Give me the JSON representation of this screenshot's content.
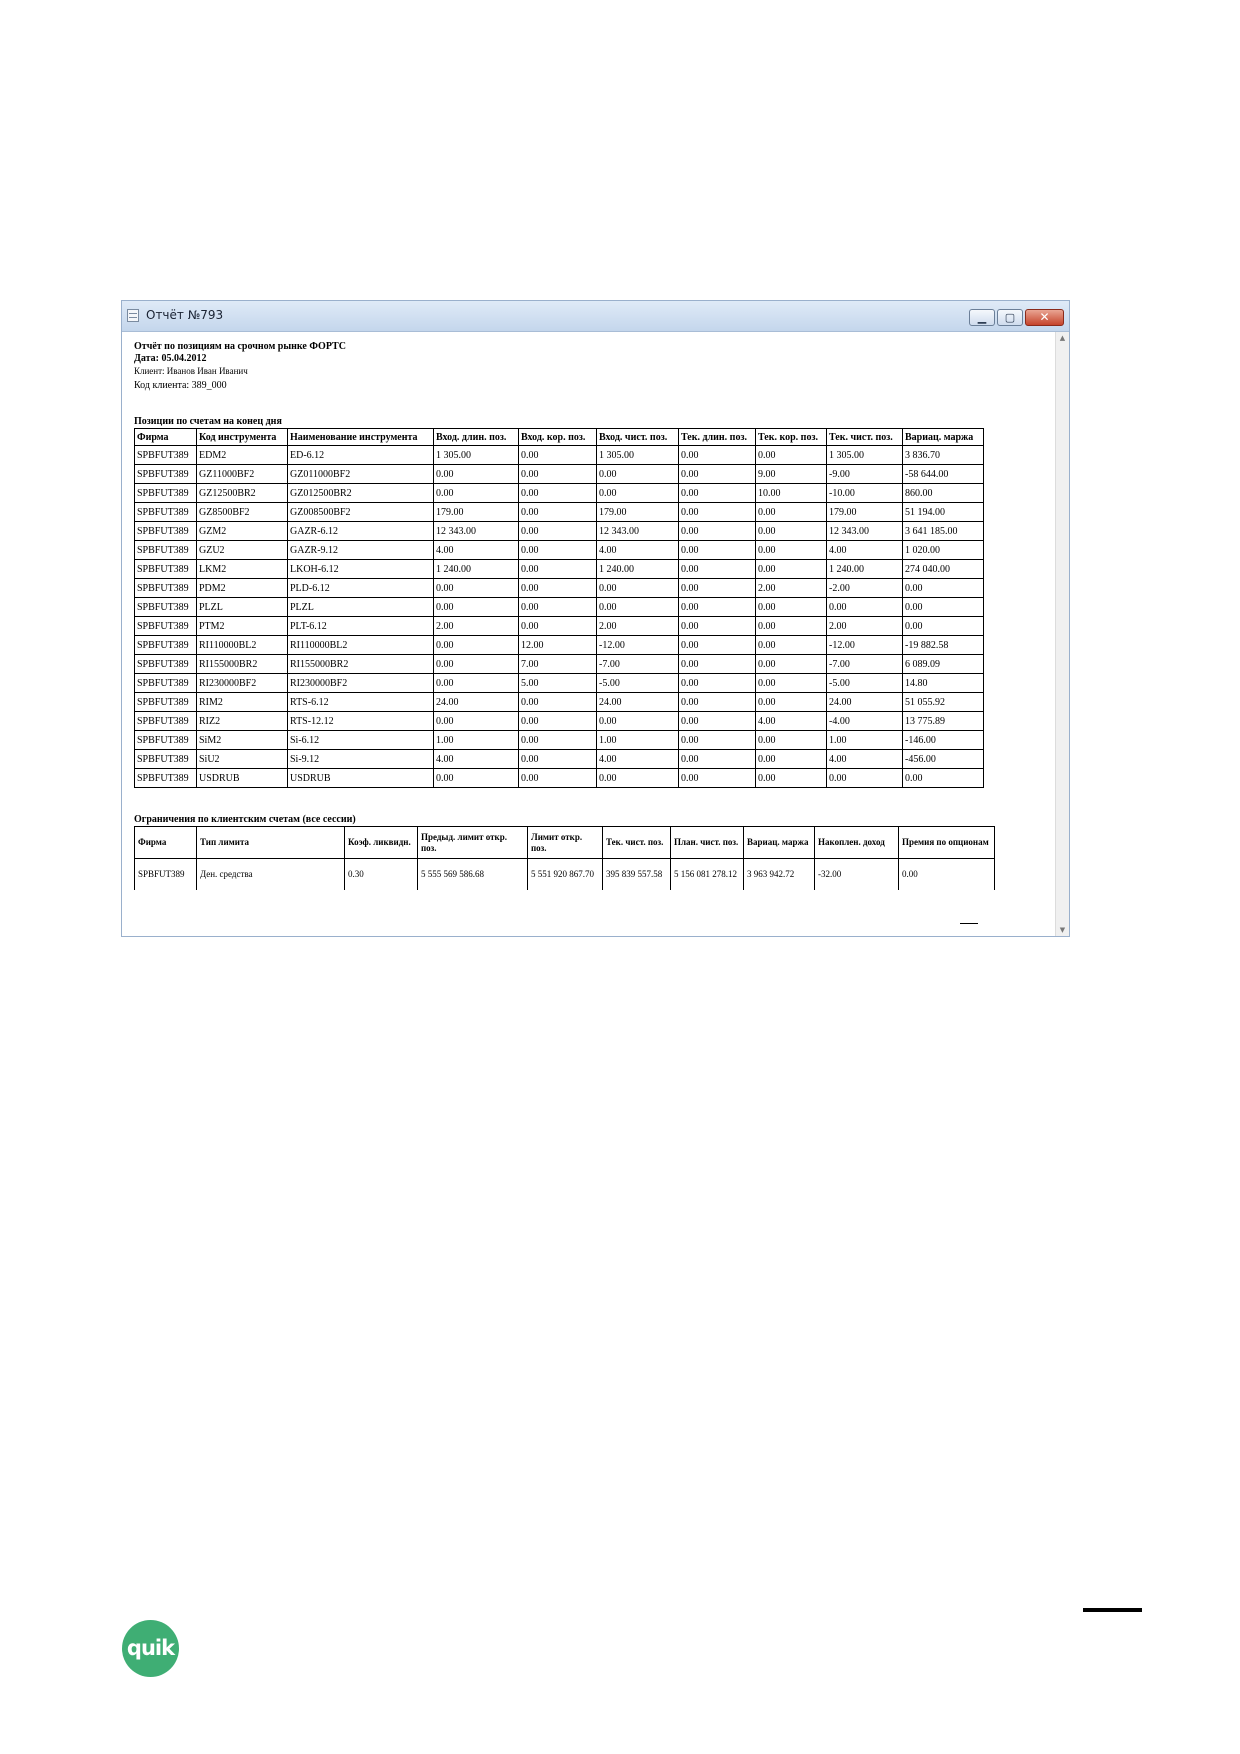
{
  "window": {
    "title": "Отчёт №793",
    "minimize_glyph": "▁",
    "maximize_glyph": "▢",
    "close_glyph": "✕"
  },
  "report": {
    "title": "Отчёт по позициям на срочном рынке ФОРТС",
    "date": "Дата: 05.04.2012",
    "client": "Клиент: Иванов Иван Иванич",
    "client_code": "Код клиента: 389_000"
  },
  "positions": {
    "section_title": "Позиции по счетам на конец дня",
    "columns": [
      "Фирма",
      "Код инструмента",
      "Наименование инструмента",
      "Вход. длин. поз.",
      "Вход. кор. поз.",
      "Вход. чист. поз.",
      "Тек. длин. поз.",
      "Тек. кор. поз.",
      "Тек. чист. поз.",
      "Вариац. маржа"
    ],
    "rows": [
      [
        "SPBFUT389",
        "EDM2",
        "ED-6.12",
        "1 305.00",
        "0.00",
        "1 305.00",
        "0.00",
        "0.00",
        "1 305.00",
        "3 836.70"
      ],
      [
        "SPBFUT389",
        "GZ11000BF2",
        "GZ011000BF2",
        "0.00",
        "0.00",
        "0.00",
        "0.00",
        "9.00",
        "-9.00",
        "-58 644.00"
      ],
      [
        "SPBFUT389",
        "GZ12500BR2",
        "GZ012500BR2",
        "0.00",
        "0.00",
        "0.00",
        "0.00",
        "10.00",
        "-10.00",
        "860.00"
      ],
      [
        "SPBFUT389",
        "GZ8500BF2",
        "GZ008500BF2",
        "179.00",
        "0.00",
        "179.00",
        "0.00",
        "0.00",
        "179.00",
        "51 194.00"
      ],
      [
        "SPBFUT389",
        "GZM2",
        "GAZR-6.12",
        "12 343.00",
        "0.00",
        "12 343.00",
        "0.00",
        "0.00",
        "12 343.00",
        "3 641 185.00"
      ],
      [
        "SPBFUT389",
        "GZU2",
        "GAZR-9.12",
        "4.00",
        "0.00",
        "4.00",
        "0.00",
        "0.00",
        "4.00",
        "1 020.00"
      ],
      [
        "SPBFUT389",
        "LKM2",
        "LKOH-6.12",
        "1 240.00",
        "0.00",
        "1 240.00",
        "0.00",
        "0.00",
        "1 240.00",
        "274 040.00"
      ],
      [
        "SPBFUT389",
        "PDM2",
        "PLD-6.12",
        "0.00",
        "0.00",
        "0.00",
        "0.00",
        "2.00",
        "-2.00",
        "0.00"
      ],
      [
        "SPBFUT389",
        "PLZL",
        "PLZL",
        "0.00",
        "0.00",
        "0.00",
        "0.00",
        "0.00",
        "0.00",
        "0.00"
      ],
      [
        "SPBFUT389",
        "PTM2",
        "PLT-6.12",
        "2.00",
        "0.00",
        "2.00",
        "0.00",
        "0.00",
        "2.00",
        "0.00"
      ],
      [
        "SPBFUT389",
        "RI110000BL2",
        "RI110000BL2",
        "0.00",
        "12.00",
        "-12.00",
        "0.00",
        "0.00",
        "-12.00",
        "-19 882.58"
      ],
      [
        "SPBFUT389",
        "RI155000BR2",
        "RI155000BR2",
        "0.00",
        "7.00",
        "-7.00",
        "0.00",
        "0.00",
        "-7.00",
        "6 089.09"
      ],
      [
        "SPBFUT389",
        "RI230000BF2",
        "RI230000BF2",
        "0.00",
        "5.00",
        "-5.00",
        "0.00",
        "0.00",
        "-5.00",
        "14.80"
      ],
      [
        "SPBFUT389",
        "RIM2",
        "RTS-6.12",
        "24.00",
        "0.00",
        "24.00",
        "0.00",
        "0.00",
        "24.00",
        "51 055.92"
      ],
      [
        "SPBFUT389",
        "RIZ2",
        "RTS-12.12",
        "0.00",
        "0.00",
        "0.00",
        "0.00",
        "4.00",
        "-4.00",
        "13 775.89"
      ],
      [
        "SPBFUT389",
        "SiM2",
        "Si-6.12",
        "1.00",
        "0.00",
        "1.00",
        "0.00",
        "0.00",
        "1.00",
        "-146.00"
      ],
      [
        "SPBFUT389",
        "SiU2",
        "Si-9.12",
        "4.00",
        "0.00",
        "4.00",
        "0.00",
        "0.00",
        "4.00",
        "-456.00"
      ],
      [
        "SPBFUT389",
        "USDRUB",
        "USDRUB",
        "0.00",
        "0.00",
        "0.00",
        "0.00",
        "0.00",
        "0.00",
        "0.00"
      ]
    ]
  },
  "limits": {
    "section_title": "Ограничения по клиентским счетам (все сессии)",
    "columns": [
      "Фирма",
      "Тип лимита",
      "Коэф. ликвидн.",
      "Предыд. лимит откр. поз.",
      "Лимит откр. поз.",
      "Тек. чист. поз.",
      "План. чист. поз.",
      "Вариац. маржа",
      "Накоплен. доход",
      "Премия по опционам"
    ],
    "rows": [
      [
        "SPBFUT389",
        "Ден. средства",
        "0.30",
        "5 555 569 586.68",
        "5 551 920 867.70",
        "395 839 557.58",
        "5 156 081 278.12",
        "3 963 942.72",
        "-32.00",
        "0.00"
      ]
    ]
  },
  "page": {
    "logo_text": "quik",
    "colors": {
      "logo": "#3fae74",
      "titlebar": "#c4d6ec",
      "close_button": "#c5432b"
    }
  }
}
